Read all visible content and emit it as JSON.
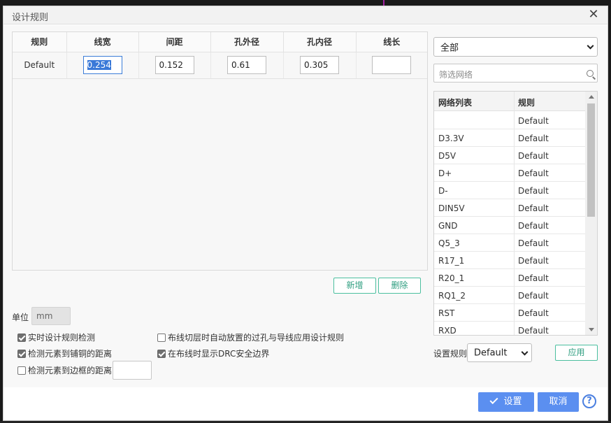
{
  "dialog": {
    "title": "设计规则",
    "close_glyph": "✕"
  },
  "rules_table": {
    "columns": [
      "规则",
      "线宽",
      "间距",
      "孔外径",
      "孔内径",
      "线长"
    ],
    "rows": [
      {
        "name": "Default",
        "width": "0.254",
        "spacing": "0.152",
        "via_outer": "0.61",
        "via_inner": "0.305",
        "length": ""
      }
    ]
  },
  "buttons": {
    "add": "新增",
    "delete": "删除",
    "apply": "应用",
    "confirm": "设置",
    "cancel": "取消",
    "help": "?"
  },
  "unit": {
    "label": "单位",
    "value": "mm"
  },
  "options": [
    {
      "label": "实时设计规则检测",
      "checked": true
    },
    {
      "label": "检测元素到铺铜的距离",
      "checked": true
    },
    {
      "label": "检测元素到边框的距离",
      "checked": false
    },
    {
      "label": "布线切层时自动放置的过孔与导线应用设计规则",
      "checked": false
    },
    {
      "label": "在布线时显示DRC安全边界",
      "checked": true
    }
  ],
  "filter": {
    "selected": "全部",
    "search_placeholder": "筛选网络"
  },
  "net_list": {
    "headers": [
      "网络列表",
      "规则"
    ],
    "rows": [
      {
        "net": "",
        "rule": "Default"
      },
      {
        "net": "D3.3V",
        "rule": "Default"
      },
      {
        "net": "D5V",
        "rule": "Default"
      },
      {
        "net": "D+",
        "rule": "Default"
      },
      {
        "net": "D-",
        "rule": "Default"
      },
      {
        "net": "DIN5V",
        "rule": "Default"
      },
      {
        "net": "GND",
        "rule": "Default"
      },
      {
        "net": "Q5_3",
        "rule": "Default"
      },
      {
        "net": "R17_1",
        "rule": "Default"
      },
      {
        "net": "R20_1",
        "rule": "Default"
      },
      {
        "net": "RQ1_2",
        "rule": "Default"
      },
      {
        "net": "RST",
        "rule": "Default"
      },
      {
        "net": "RXD",
        "rule": "Default"
      }
    ]
  },
  "set_rule": {
    "label": "设置规则",
    "value": "Default"
  },
  "colors": {
    "accent": "#5b8ff0",
    "outline_button": "#4bbf9f",
    "selection": "#3a79d8"
  }
}
